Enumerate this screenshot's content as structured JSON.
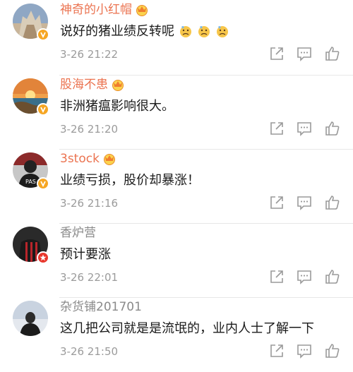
{
  "comments": [
    {
      "username": "神奇的小红帽",
      "name_style": "vip",
      "text": "说好的猪业绩反转呢",
      "emoji": [
        "sad-face",
        "sad-face",
        "sad-face"
      ],
      "time": "3-26 21:22",
      "badge": "verified"
    },
    {
      "username": "股海不患",
      "name_style": "vip",
      "text": "非洲猪瘟影响很大。",
      "time": "3-26 21:20",
      "badge": "verified"
    },
    {
      "username": "3stock",
      "name_style": "vip",
      "text": "业绩亏损，股价却暴涨！",
      "time": "3-26 21:16",
      "badge": "verified"
    },
    {
      "username": "香炉营",
      "name_style": "normal",
      "text": "预计要涨",
      "time": "3-26 22:01",
      "badge": "star"
    },
    {
      "username": "杂货铺201701",
      "name_style": "normal",
      "text": "这几把公司就是是流氓的，业内人士了解一下",
      "time": "3-26 21:50",
      "badge": "none"
    }
  ],
  "icons": {
    "forward": "forward-icon",
    "reply": "comment-icon",
    "like": "thumbs-up-icon",
    "crown": "vip-crown-icon"
  },
  "colors": {
    "vip_name": "#eb7350",
    "normal_name": "#8a8a8a",
    "verified_badge": "#f6a623",
    "star_badge": "#e8372d"
  }
}
